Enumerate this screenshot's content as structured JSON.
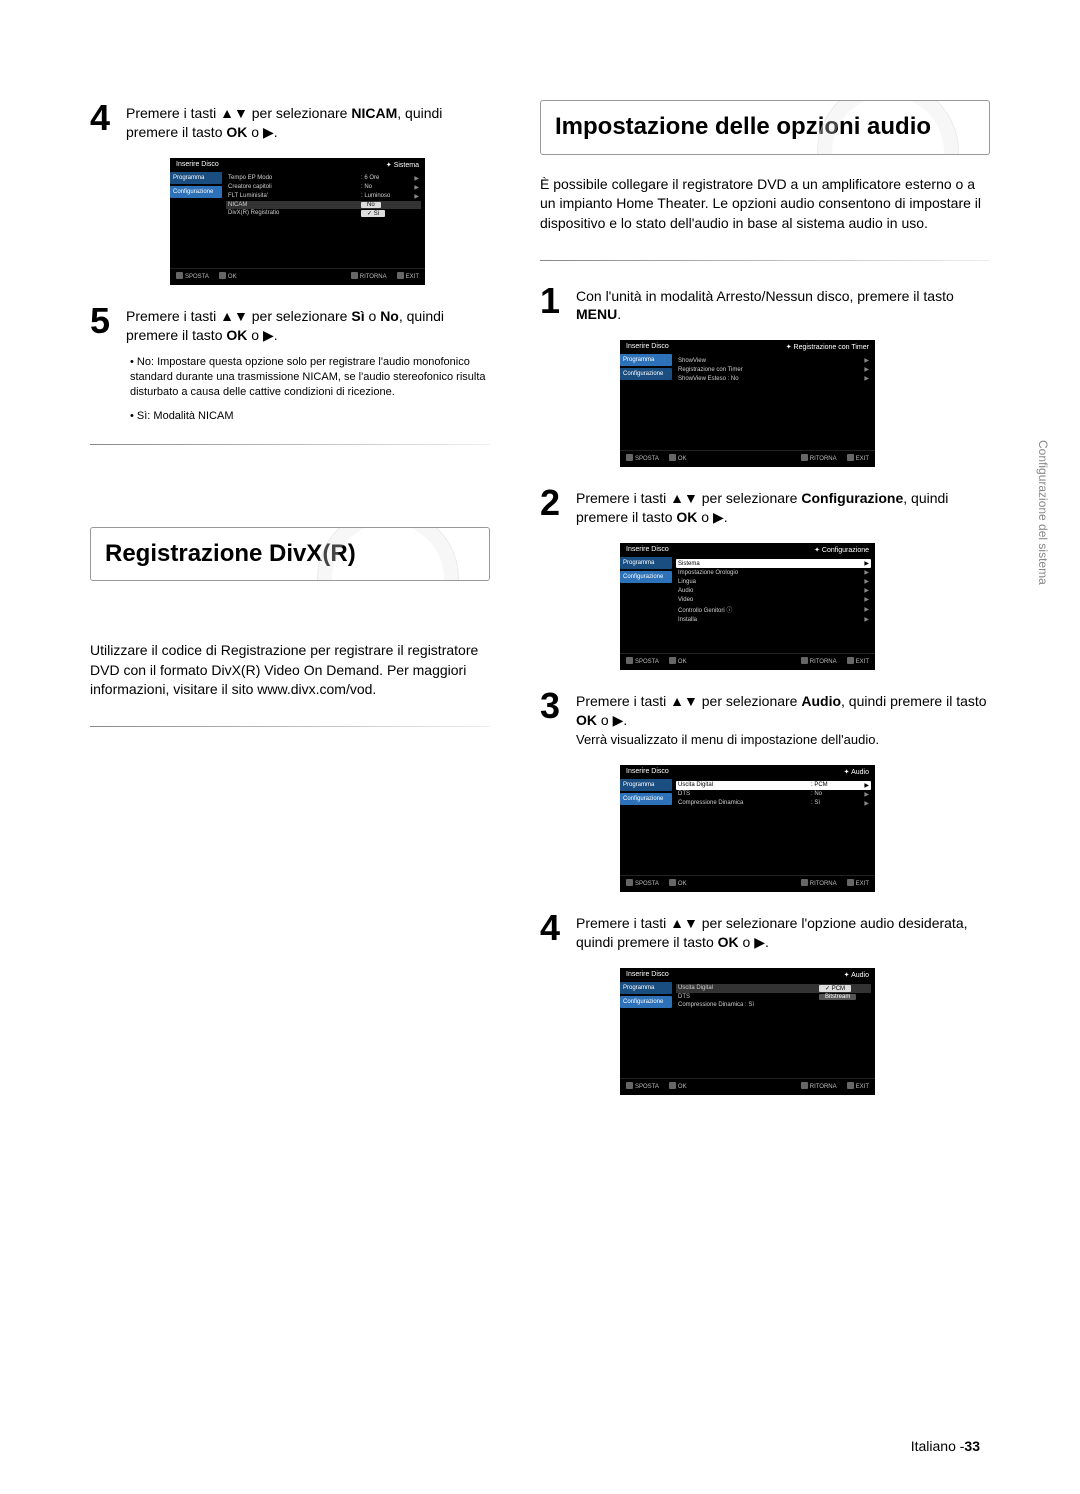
{
  "side_tab": "Configurazione del sistema",
  "left": {
    "step4": {
      "num": "4",
      "text_before": "Premere i tasti ",
      "arrows": "▲▼",
      "text_mid1": " per selezionare ",
      "bold1": "NICAM",
      "text_mid2": ", quindi premere il tasto ",
      "bold2": "OK",
      "text_after": " o ▶."
    },
    "osd4": {
      "title_left": "Inserire Disco",
      "title_right": "Sistema",
      "side1": "Programma",
      "side2": "Configurazione",
      "rows": [
        {
          "lab": "Tempo EP Modo",
          "val": ": 6 Ore",
          "arr": "▶"
        },
        {
          "lab": "Creatore capitoli",
          "val": ": No",
          "arr": "▶"
        },
        {
          "lab": "FLT Luminisita'",
          "val": ": Luminoso",
          "arr": "▶"
        },
        {
          "lab": "NICAM",
          "val": "",
          "arr": ""
        },
        {
          "lab": "DivX(R) Registratio",
          "val": "",
          "arr": ""
        }
      ],
      "opt_no": "No",
      "opt_si": "Sì",
      "footer": [
        "SPOSTA",
        "OK",
        "RITORNA",
        "EXIT"
      ]
    },
    "step5": {
      "num": "5",
      "text_before": "Premere i tasti ",
      "arrows": "▲▼",
      "text_mid1": " per selezionare ",
      "bold1": "Sì",
      "text_mid2": " o ",
      "bold2": "No",
      "text_mid3": ", quindi premere il tasto ",
      "bold3": "OK",
      "text_after": " o ▶."
    },
    "bullets": [
      "• No: Impostare questa opzione solo per registrare l'audio monofonico standard durante una trasmissione NICAM, se l'audio stereofonico risulta disturbato a causa delle cattive condizioni di ricezione.",
      "• Sì: Modalità NICAM"
    ],
    "section_title": "Registrazione DivX(R)",
    "paragraph": "Utilizzare il codice di Registrazione per registrare il registratore DVD con il formato DivX(R) Video On Demand. Per maggiori informazioni, visitare il sito www.divx.com/vod."
  },
  "right": {
    "section_title": "Impostazione delle opzioni audio",
    "intro": "È possibile collegare il registratore DVD a un amplificatore esterno o a un impianto Home Theater. Le opzioni audio consentono di impostare il dispositivo e lo stato dell'audio in base al sistema audio in uso.",
    "step1": {
      "num": "1",
      "text_before": "Con l'unità in modalità Arresto/Nessun disco, premere il tasto ",
      "bold1": "MENU",
      "text_after": "."
    },
    "osd1": {
      "title_left": "Inserire Disco",
      "title_right": "Registrazione con Timer",
      "side1": "Programma",
      "side2": "Configurazione",
      "rows": [
        {
          "lab": "ShowView",
          "val": "",
          "arr": "▶"
        },
        {
          "lab": "Registrazione con Timer",
          "val": "",
          "arr": "▶"
        },
        {
          "lab": "ShowView Esteso : No",
          "val": "",
          "arr": "▶"
        }
      ],
      "footer": [
        "SPOSTA",
        "OK",
        "RITORNA",
        "EXIT"
      ]
    },
    "step2": {
      "num": "2",
      "text_before": "Premere i tasti ",
      "arrows": "▲▼",
      "text_mid1": " per selezionare ",
      "bold1": "Configurazione",
      "text_mid2": ", quindi premere il tasto ",
      "bold2": "OK",
      "text_after": " o ▶."
    },
    "osd2": {
      "title_left": "Inserire Disco",
      "title_right": "Configurazione",
      "side1": "Programma",
      "side2": "Configurazione",
      "rows": [
        {
          "lab": "Sistema",
          "val": "",
          "arr": "▶",
          "hl": true
        },
        {
          "lab": "Impostazione Orologio",
          "val": "",
          "arr": "▶"
        },
        {
          "lab": "Lingua",
          "val": "",
          "arr": "▶"
        },
        {
          "lab": "Audio",
          "val": "",
          "arr": "▶"
        },
        {
          "lab": "Video",
          "val": "",
          "arr": "▶"
        },
        {
          "lab": "Controllo Genitori ⓘ",
          "val": "",
          "arr": "▶"
        },
        {
          "lab": "Installa",
          "val": "",
          "arr": "▶"
        }
      ],
      "footer": [
        "SPOSTA",
        "OK",
        "RITORNA",
        "EXIT"
      ]
    },
    "step3": {
      "num": "3",
      "text_before": "Premere i tasti ",
      "arrows": "▲▼",
      "text_mid1": " per selezionare ",
      "bold1": "Audio",
      "text_mid2": ", quindi premere il tasto ",
      "bold2": "OK",
      "text_after": " o ▶.",
      "sub": "Verrà visualizzato il menu di impostazione dell'audio."
    },
    "osd3": {
      "title_left": "Inserire Disco",
      "title_right": "Audio",
      "side1": "Programma",
      "side2": "Configurazione",
      "rows": [
        {
          "lab": "Uscita Digital",
          "val": ": PCM",
          "arr": "▶",
          "hl": true
        },
        {
          "lab": "DTS",
          "val": ": No",
          "arr": "▶"
        },
        {
          "lab": "Compressione Dinamica",
          "val": ": Sì",
          "arr": "▶"
        }
      ],
      "footer": [
        "SPOSTA",
        "OK",
        "RITORNA",
        "EXIT"
      ]
    },
    "step4": {
      "num": "4",
      "text_before": "Premere i tasti ",
      "arrows": "▲▼",
      "text_mid1": " per selezionare l'opzione audio desiderata, quindi premere il tasto ",
      "bold1": "OK",
      "text_after": " o  ▶."
    },
    "osd4r": {
      "title_left": "Inserire Disco",
      "title_right": "Audio",
      "side1": "Programma",
      "side2": "Configurazione",
      "rows": [
        {
          "lab": "Uscita Digital",
          "val": "",
          "arr": ""
        },
        {
          "lab": "DTS",
          "val": "",
          "arr": ""
        },
        {
          "lab": "Compressione Dinamica  : Sì",
          "val": "",
          "arr": ""
        }
      ],
      "opt_pcm": "PCM",
      "opt_bit": "Bitstream",
      "footer": [
        "SPOSTA",
        "OK",
        "RITORNA",
        "EXIT"
      ]
    }
  },
  "footer": {
    "lang": "Italiano -",
    "page": "33"
  }
}
